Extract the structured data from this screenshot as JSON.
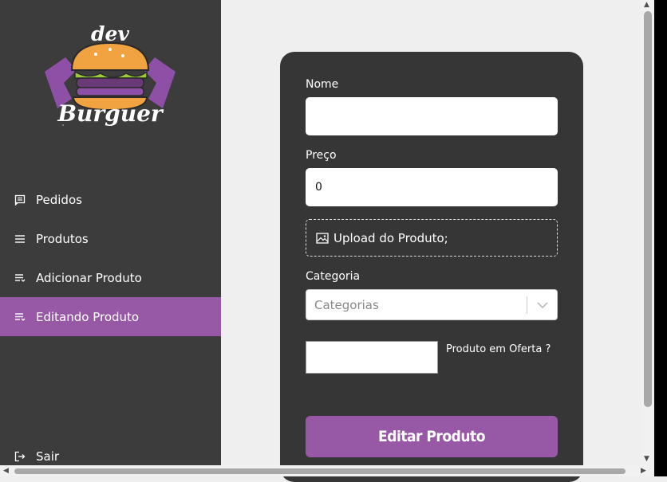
{
  "logo": {
    "top_text": "dev",
    "bottom_text": "Burguer"
  },
  "nav": {
    "items": [
      {
        "label": "Pedidos",
        "icon": "receipt-icon"
      },
      {
        "label": "Produtos",
        "icon": "list-icon"
      },
      {
        "label": "Adicionar Produto",
        "icon": "playlist-add-icon"
      },
      {
        "label": "Editando Produto",
        "icon": "playlist-edit-icon",
        "active": true
      }
    ],
    "logout_label": "Sair"
  },
  "form": {
    "name_label": "Nome",
    "name_value": "",
    "price_label": "Preço",
    "price_value": "0",
    "upload_label": "Upload do Produto;",
    "category_label": "Categoria",
    "category_placeholder": "Categorias",
    "offer_label": "Produto em Oferta ?",
    "submit_label": "Editar Produto"
  },
  "colors": {
    "sidebar_bg": "#3c3c3c",
    "accent": "#9758a6",
    "card_bg": "#363636",
    "page_bg": "#efefef"
  }
}
